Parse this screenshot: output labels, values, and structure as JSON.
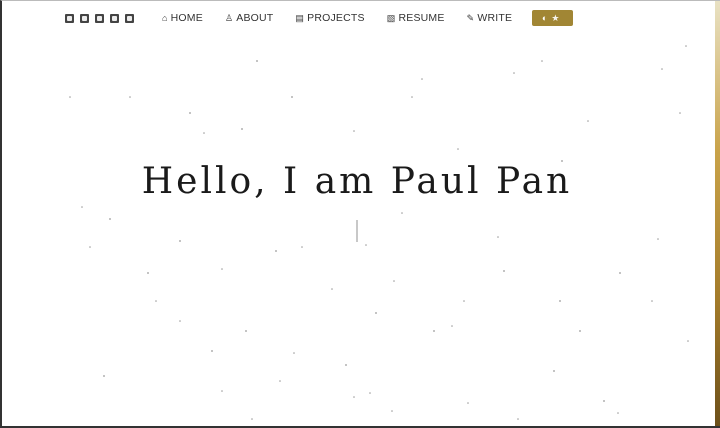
{
  "nav": {
    "social_icons": [
      "github-icon",
      "linkedin-icon",
      "facebook-icon",
      "twitter-icon",
      "instagram-icon"
    ],
    "links": [
      {
        "label": "HOME",
        "icon": "home-icon",
        "glyph": "⌂"
      },
      {
        "label": "ABOUT",
        "icon": "user-icon",
        "glyph": "♙"
      },
      {
        "label": "PROJECTS",
        "icon": "projects-icon",
        "glyph": "▤"
      },
      {
        "label": "RESUME",
        "icon": "resume-icon",
        "glyph": "▧"
      },
      {
        "label": "WRITE",
        "icon": "pen-icon",
        "glyph": "✎"
      }
    ],
    "theme_button": {
      "glyph_left": "◐",
      "glyph_right": "★",
      "color": "#a18634"
    }
  },
  "hero": {
    "title": "Hello, I am Paul Pan"
  },
  "colors": {
    "accent": "#a18634",
    "text": "#1a1a1a"
  }
}
